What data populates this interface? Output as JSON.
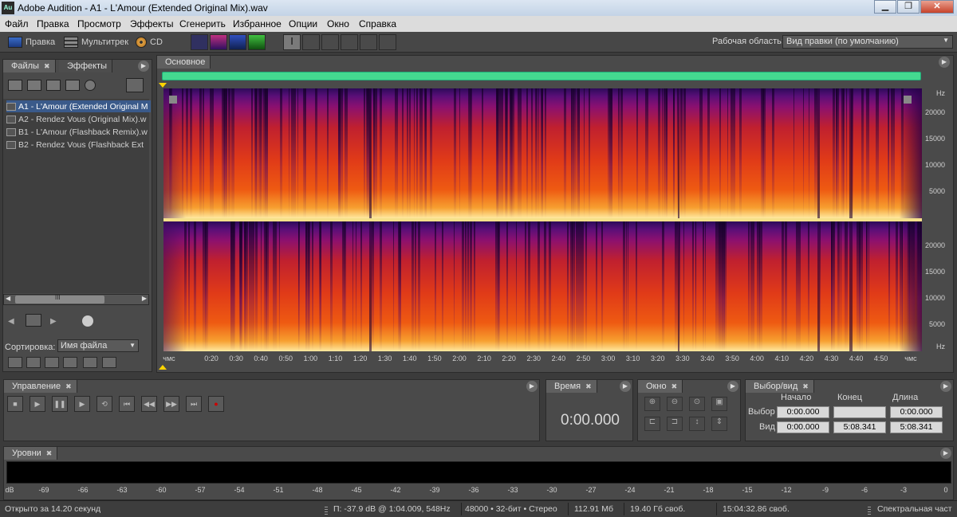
{
  "window": {
    "app_icon": "Au",
    "title": "Adobe Audition - A1 - L'Amour (Extended Original Mix).wav",
    "min_icon": "minimize-icon",
    "max_icon": "maximize-icon",
    "close": "✕"
  },
  "menu": [
    "Файл",
    "Правка",
    "Просмотр",
    "Эффекты",
    "Сгенерить",
    "Избранное",
    "Опции",
    "Окно",
    "Справка"
  ],
  "toolbar": {
    "edit": "Правка",
    "multitrack": "Мультитрек",
    "cd": "CD",
    "workspace_label": "Рабочая область:",
    "workspace_value": "Вид правки (по умолчанию)"
  },
  "files_panel": {
    "tab_files": "Файлы",
    "tab_effects": "Эффекты",
    "items": [
      "A1 - L'Amour (Extended Original M",
      "A2 - Rendez Vous (Original Mix).w",
      "B1 - L'Amour (Flashback Remix).w",
      "B2 - Rendez Vous (Flashback Ext"
    ],
    "scroll_grip": "III",
    "sort_label": "Сортировка:",
    "sort_value": "Имя файла"
  },
  "editor": {
    "tab": "Основное",
    "hz_label": "Hz",
    "hz_ticks": [
      "20000",
      "15000",
      "10000",
      "5000"
    ],
    "time_start": "чмс",
    "time_end": "чмс",
    "time_ticks": [
      "0:20",
      "0:30",
      "0:40",
      "0:50",
      "1:00",
      "1:10",
      "1:20",
      "1:30",
      "1:40",
      "1:50",
      "2:00",
      "2:10",
      "2:20",
      "2:30",
      "2:40",
      "2:50",
      "3:00",
      "3:10",
      "3:20",
      "3:30",
      "3:40",
      "3:50",
      "4:00",
      "4:10",
      "4:20",
      "4:30",
      "4:40",
      "4:50"
    ]
  },
  "transport": {
    "tab": "Управление"
  },
  "time_panel": {
    "tab": "Время",
    "value": "0:00.000"
  },
  "zoom_panel": {
    "tab": "Окно"
  },
  "selection_panel": {
    "tab": "Выбор/вид",
    "col_start": "Начало",
    "col_end": "Конец",
    "col_length": "Длина",
    "row_selection": "Выбор",
    "row_view": "Вид",
    "sel_start": "0:00.000",
    "sel_end": "",
    "sel_length": "0:00.000",
    "view_start": "0:00.000",
    "view_end": "5:08.341",
    "view_length": "5:08.341"
  },
  "levels_panel": {
    "tab": "Уровни",
    "db_ticks": [
      "dB",
      "-69",
      "-66",
      "-63",
      "-60",
      "-57",
      "-54",
      "-51",
      "-48",
      "-45",
      "-42",
      "-39",
      "-36",
      "-33",
      "-30",
      "-27",
      "-24",
      "-21",
      "-18",
      "-15",
      "-12",
      "-9",
      "-6",
      "-3",
      "0"
    ]
  },
  "status": {
    "opened": "Открыто за 14.20 секунд",
    "cursor": "П: -37.9 dB @  1:04.009, 548Hz",
    "format": "48000 • 32-бит • Стерео",
    "size": "112.91 Мб",
    "free": "19.40 Гб своб.",
    "time_free": "15:04:32.86 своб.",
    "view_mode": "Спектральная част"
  },
  "colors": {
    "overview": "#44d990",
    "accent": "#3a5a8a"
  }
}
